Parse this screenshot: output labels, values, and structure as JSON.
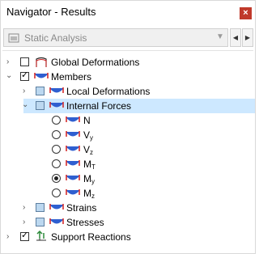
{
  "window": {
    "title": "Navigator - Results",
    "close_label": "×"
  },
  "toolbar": {
    "analysis_select_value": "Static Analysis",
    "prev_label": "◀",
    "next_label": "▶"
  },
  "tree": {
    "global_deformations": "Global Deformations",
    "members": "Members",
    "local_deformations": "Local Deformations",
    "internal_forces": "Internal Forces",
    "forces": [
      {
        "main": "N",
        "sub": ""
      },
      {
        "main": "V",
        "sub": "y"
      },
      {
        "main": "V",
        "sub": "z"
      },
      {
        "main": "M",
        "sub": "T"
      },
      {
        "main": "M",
        "sub": "y"
      },
      {
        "main": "M",
        "sub": "z"
      }
    ],
    "strains": "Strains",
    "stresses": "Stresses",
    "support_reactions": "Support Reactions"
  },
  "colors": {
    "selection": "#cde8ff",
    "close_button": "#c0392b",
    "member_icon_blue": "#2f5fd0",
    "member_icon_red": "#d21f1f",
    "support_icon_green": "#2e8b3b"
  }
}
